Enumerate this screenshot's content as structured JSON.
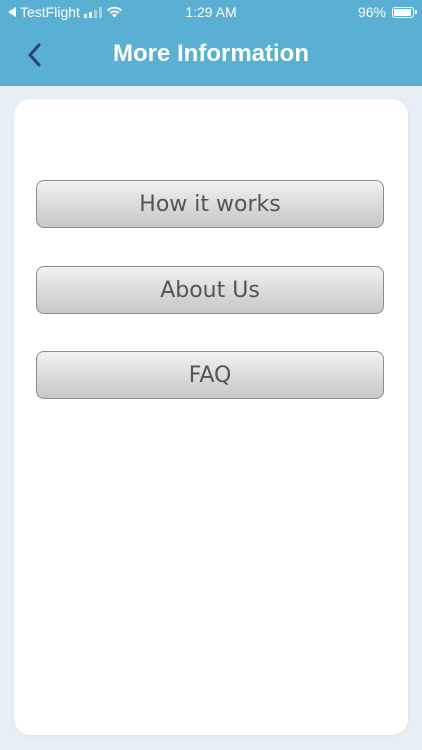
{
  "status_bar": {
    "back_app": "TestFlight",
    "time": "1:29 AM",
    "battery": "96%",
    "battery_level": 0.96
  },
  "header": {
    "title": "More Information"
  },
  "menu": {
    "items": [
      {
        "label": "How it works"
      },
      {
        "label": "About Us"
      },
      {
        "label": "FAQ"
      }
    ]
  },
  "colors": {
    "header_bg": "#5ab0d2",
    "page_bg": "#e7eef6",
    "back_arrow": "#2b3f7a"
  },
  "icons": [
    "back-triangle-icon",
    "signal-icon",
    "wifi-icon",
    "battery-icon",
    "chevron-left-icon"
  ]
}
